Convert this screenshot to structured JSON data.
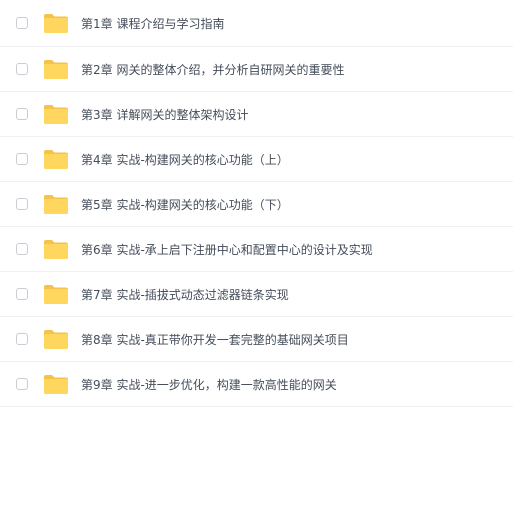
{
  "colors": {
    "folder_body": "#FFD75E",
    "folder_tab": "#F5C24A",
    "text": "#454d5a",
    "divider": "#eef0f3",
    "checkbox_border": "#c9cdd4"
  },
  "file_list": {
    "items": [
      {
        "label": "第1章 课程介绍与学习指南",
        "icon": "folder-icon",
        "checked": false
      },
      {
        "label": "第2章 网关的整体介绍，并分析自研网关的重要性",
        "icon": "folder-icon",
        "checked": false
      },
      {
        "label": "第3章 详解网关的整体架构设计",
        "icon": "folder-icon",
        "checked": false
      },
      {
        "label": "第4章 实战-构建网关的核心功能（上）",
        "icon": "folder-icon",
        "checked": false
      },
      {
        "label": "第5章 实战-构建网关的核心功能（下）",
        "icon": "folder-icon",
        "checked": false
      },
      {
        "label": "第6章 实战-承上启下注册中心和配置中心的设计及实现",
        "icon": "folder-icon",
        "checked": false
      },
      {
        "label": "第7章 实战-插拔式动态过滤器链条实现",
        "icon": "folder-icon",
        "checked": false
      },
      {
        "label": "第8章 实战-真正带你开发一套完整的基础网关项目",
        "icon": "folder-icon",
        "checked": false
      },
      {
        "label": "第9章 实战-进一步优化，构建一款高性能的网关",
        "icon": "folder-icon",
        "checked": false
      }
    ]
  }
}
